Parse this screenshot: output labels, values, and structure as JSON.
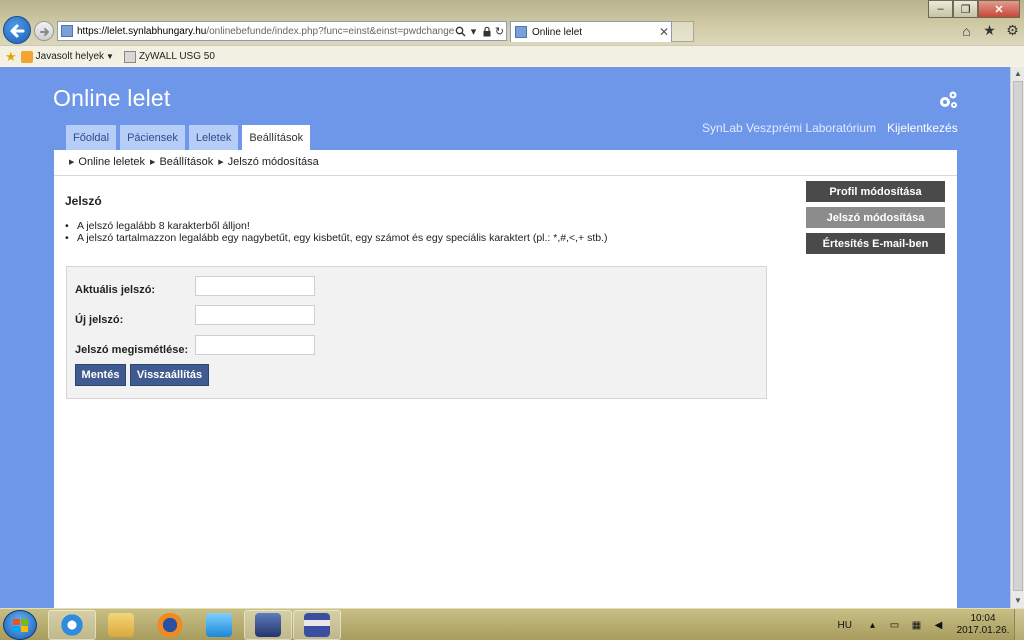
{
  "browser": {
    "url_host": "https://lelet.synlabhungary.hu",
    "url_rest": "/onlinebefunde/index.php?func=einst&einst=pwdchange",
    "tab_title": "Online lelet",
    "favorites": {
      "suggested_label": "Javasolt helyek",
      "zywall_label": "ZyWALL USG 50"
    },
    "icons": [
      "back-arrow-icon",
      "forward-arrow-icon",
      "search-icon",
      "lock-icon",
      "refresh-icon",
      "home-icon",
      "star-icon",
      "gear-icon"
    ]
  },
  "site": {
    "title": "Online lelet",
    "lab_name": "SynLab Veszprémi Laboratórium",
    "logout": "Kijelentkezés",
    "tabs": [
      "Főoldal",
      "Páciensek",
      "Leletek",
      "Beállítások"
    ],
    "active_tab": "Beállítások",
    "breadcrumb": [
      "Online leletek",
      "Beállítások",
      "Jelszó módosítása"
    ]
  },
  "main": {
    "section_title": "Jelszó",
    "rules": [
      "A jelszó legalább 8 karakterből álljon!",
      "A jelszó tartalmazzon legalább egy nagybetűt, egy kisbetűt, egy számot és egy speciális karaktert (pl.: *,#,<,+ stb.)"
    ],
    "form": {
      "current_label": "Aktuális jelszó:",
      "new_label": "Új jelszó:",
      "repeat_label": "Jelszó megismétlése:",
      "current_value": "",
      "new_value": "",
      "repeat_value": "",
      "save_button": "Mentés",
      "reset_button": "Visszaállítás"
    }
  },
  "side_menu": {
    "profile": "Profil módosítása",
    "password": "Jelszó módosítása",
    "email_notify": "Értesítés E-mail-ben"
  },
  "taskbar": {
    "lang": "HU",
    "time": "10:04",
    "date": "2017.01.26.",
    "apps": [
      "internet-explorer-icon",
      "file-explorer-icon",
      "firefox-icon",
      "media-player-icon",
      "network-tool-icon",
      "save-disk-icon"
    ]
  },
  "colors": {
    "page_bg": "#6f97e9",
    "tab_bg": "#b5cdf7",
    "form_button": "#3f5b8f",
    "side_dark": "#4a4a4a",
    "side_active": "#8c8c8c"
  }
}
